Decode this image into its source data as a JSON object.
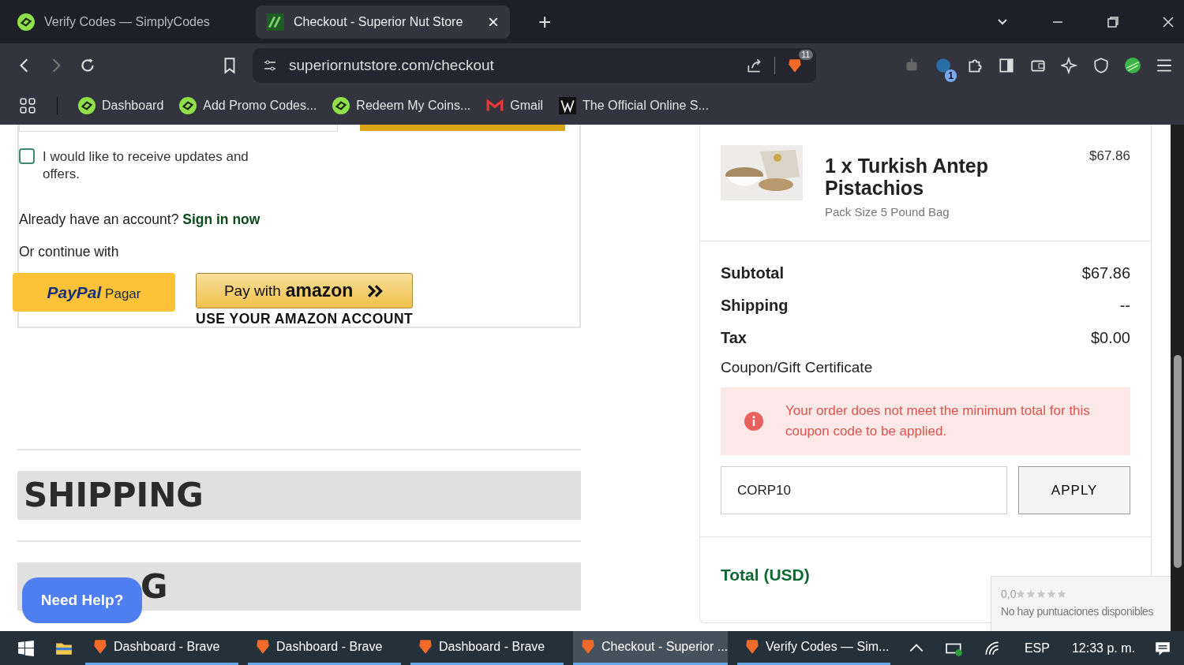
{
  "browser": {
    "tabs": [
      {
        "title": "Verify Codes — SimplyCodes",
        "selected": false
      },
      {
        "title": "Checkout - Superior Nut Store",
        "selected": true
      }
    ],
    "tab_close": "×",
    "new_tab": "+",
    "url": "superiornutstore.com/checkout",
    "shields_count": "11",
    "extension_count": "1",
    "bookmarks": [
      {
        "label": "Dashboard"
      },
      {
        "label": "Add Promo Codes..."
      },
      {
        "label": "Redeem My Coins..."
      },
      {
        "label": "Gmail"
      },
      {
        "label": "The Official Online S..."
      }
    ]
  },
  "checkout": {
    "newsletter": {
      "label": "I would like to receive updates and offers.",
      "checked": false
    },
    "account_prompt": "Already have an account?",
    "sign_in_link": "Sign in now",
    "continue_label": "Or continue with",
    "paypal": {
      "brand": "PayPal",
      "label": "Pagar"
    },
    "amazon": {
      "label": "Pay with",
      "brand": "amazon",
      "caption": "USE YOUR AMAZON ACCOUNT"
    },
    "sections": [
      {
        "title": "SHIPPING"
      },
      {
        "title": "G"
      }
    ],
    "help_button": "Need Help?"
  },
  "order": {
    "item": {
      "name": "1 x Turkish Antep Pistachios",
      "variant": "Pack Size 5 Pound Bag",
      "price": "$67.86"
    },
    "totals": [
      {
        "label": "Subtotal",
        "value": "$67.86"
      },
      {
        "label": "Shipping",
        "value": "--"
      },
      {
        "label": "Tax",
        "value": "$0.00"
      }
    ],
    "coupon_label": "Coupon/Gift Certificate",
    "alert": "Your order does not meet the minimum total for this coupon code to be applied.",
    "coupon_value": "CORP10",
    "apply_button": "APPLY",
    "total_label": "Total (USD)"
  },
  "rating": {
    "score": "0,0",
    "stars": 0,
    "text": "No hay puntuaciones disponibles"
  },
  "taskbar": {
    "items": [
      {
        "label": "Dashboard - Brave",
        "selected": false
      },
      {
        "label": "Dashboard - Brave",
        "selected": false
      },
      {
        "label": "Dashboard - Brave",
        "selected": false
      },
      {
        "label": "Checkout - Superior ...",
        "selected": true
      },
      {
        "label": "Verify Codes — Sim...",
        "selected": false
      }
    ],
    "language": "ESP",
    "time": "12:33 p. m."
  }
}
